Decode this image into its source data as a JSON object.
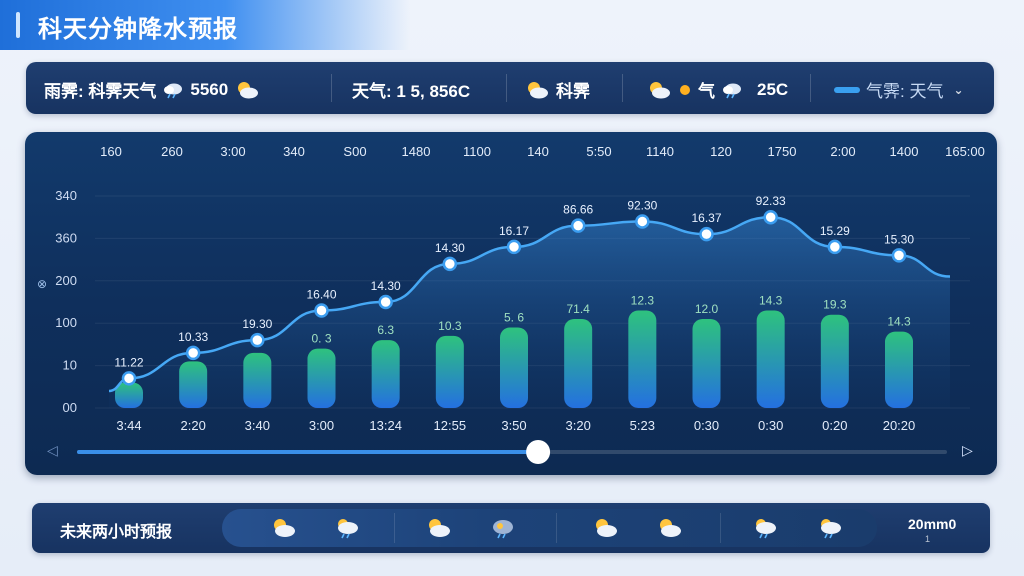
{
  "header": {
    "title": "科天分钟降水预报"
  },
  "top_bar": {
    "item1_label": "雨霁: 科霁天气",
    "item1_value": "5560",
    "item2_text": "天气: 1 5, 856C",
    "item3_text": "科霁",
    "item4_prefix": "气",
    "item4_value": "25C",
    "dropdown_text": "气霁: 天气"
  },
  "chart_data": {
    "type": "bar",
    "top_labels": [
      "160",
      "260",
      "3:00",
      "340",
      "S00",
      "1480",
      "1100",
      "140",
      "5:50",
      "1140",
      "120",
      "1750",
      "2:00",
      "1400",
      "165:00"
    ],
    "y_ticks": [
      "340",
      "360",
      "200",
      "100",
      "10",
      "00"
    ],
    "y_axis_icon": "legend-icon",
    "categories": [
      "3:44",
      "2:20",
      "3:40",
      "3:00",
      "13:24",
      "12:55",
      "3:50",
      "3:20",
      "5:23",
      "0:30",
      "0:30",
      "0:20",
      "20:20"
    ],
    "bar_values": [
      0.6,
      1.1,
      1.3,
      1.4,
      1.6,
      1.7,
      1.9,
      2.1,
      2.3,
      2.1,
      2.3,
      2.2,
      1.8
    ],
    "bar_labels": [
      "",
      "",
      "",
      "0. 3",
      "6.3",
      "10.3",
      "5. 6",
      "71.4",
      "12.3",
      "12.0",
      "14.3",
      "19.3",
      "14.3"
    ],
    "line_values": [
      0.7,
      1.3,
      1.6,
      2.3,
      2.5,
      3.4,
      3.8,
      4.3,
      4.4,
      4.1,
      4.5,
      3.8,
      3.6
    ],
    "point_labels": [
      "11.22",
      "10.33",
      "19.30",
      "16.40",
      "14.30",
      "14.30",
      "16.17",
      "86.66",
      "92.30",
      "16.37",
      "92.33",
      "15.29",
      "15.30"
    ],
    "line_end_value": 3.1,
    "ylim": [
      0,
      5
    ],
    "slider_progress": 0.53
  },
  "bottom_bar": {
    "label": "未来两小时预报",
    "icons": [
      "sun-cloud-icon",
      "rain-cloud-icon",
      "sun-cloud-icon",
      "storm-icon",
      "sun-cloud-icon",
      "sun-cloud-icon",
      "rain-cloud-icon",
      "rain-cloud-icon"
    ],
    "rain_value": "20mm0",
    "rain_sub": "1"
  },
  "colors": {
    "panel": "#123a6c",
    "line": "#46a8f5",
    "bar_top": "#2ec27e",
    "bar_bottom": "#2470e0",
    "point": "#ffffff"
  }
}
